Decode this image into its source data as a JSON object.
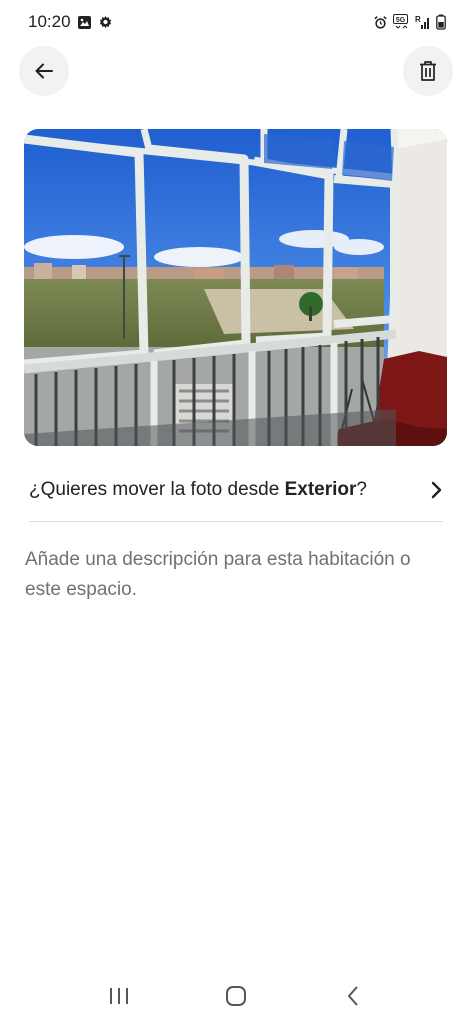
{
  "status_bar": {
    "time": "10:20",
    "left_icons": [
      "gallery-icon",
      "gear-icon"
    ],
    "right_icons": [
      "alarm-icon",
      "5g-icon",
      "signal-icon",
      "battery-icon"
    ],
    "network_label": "5G",
    "roaming_label": "R"
  },
  "header": {
    "back_icon": "arrow-left-icon",
    "delete_icon": "trash-icon"
  },
  "photo": {
    "description_icon": "photo-of-glazed-balcony"
  },
  "move_row": {
    "prefix": "¿Quieres mover la foto desde ",
    "location": "Exterior",
    "suffix": "?",
    "chevron_icon": "chevron-right-icon"
  },
  "description": {
    "placeholder": "Añade una descripción para esta habitación o este espacio."
  },
  "nav_bar": {
    "icons": [
      "recents-icon",
      "home-icon",
      "back-nav-icon"
    ]
  },
  "colors": {
    "text": "#222222",
    "muted": "#717171",
    "button_bg": "#f2f2f2",
    "divider": "#dddddd"
  }
}
